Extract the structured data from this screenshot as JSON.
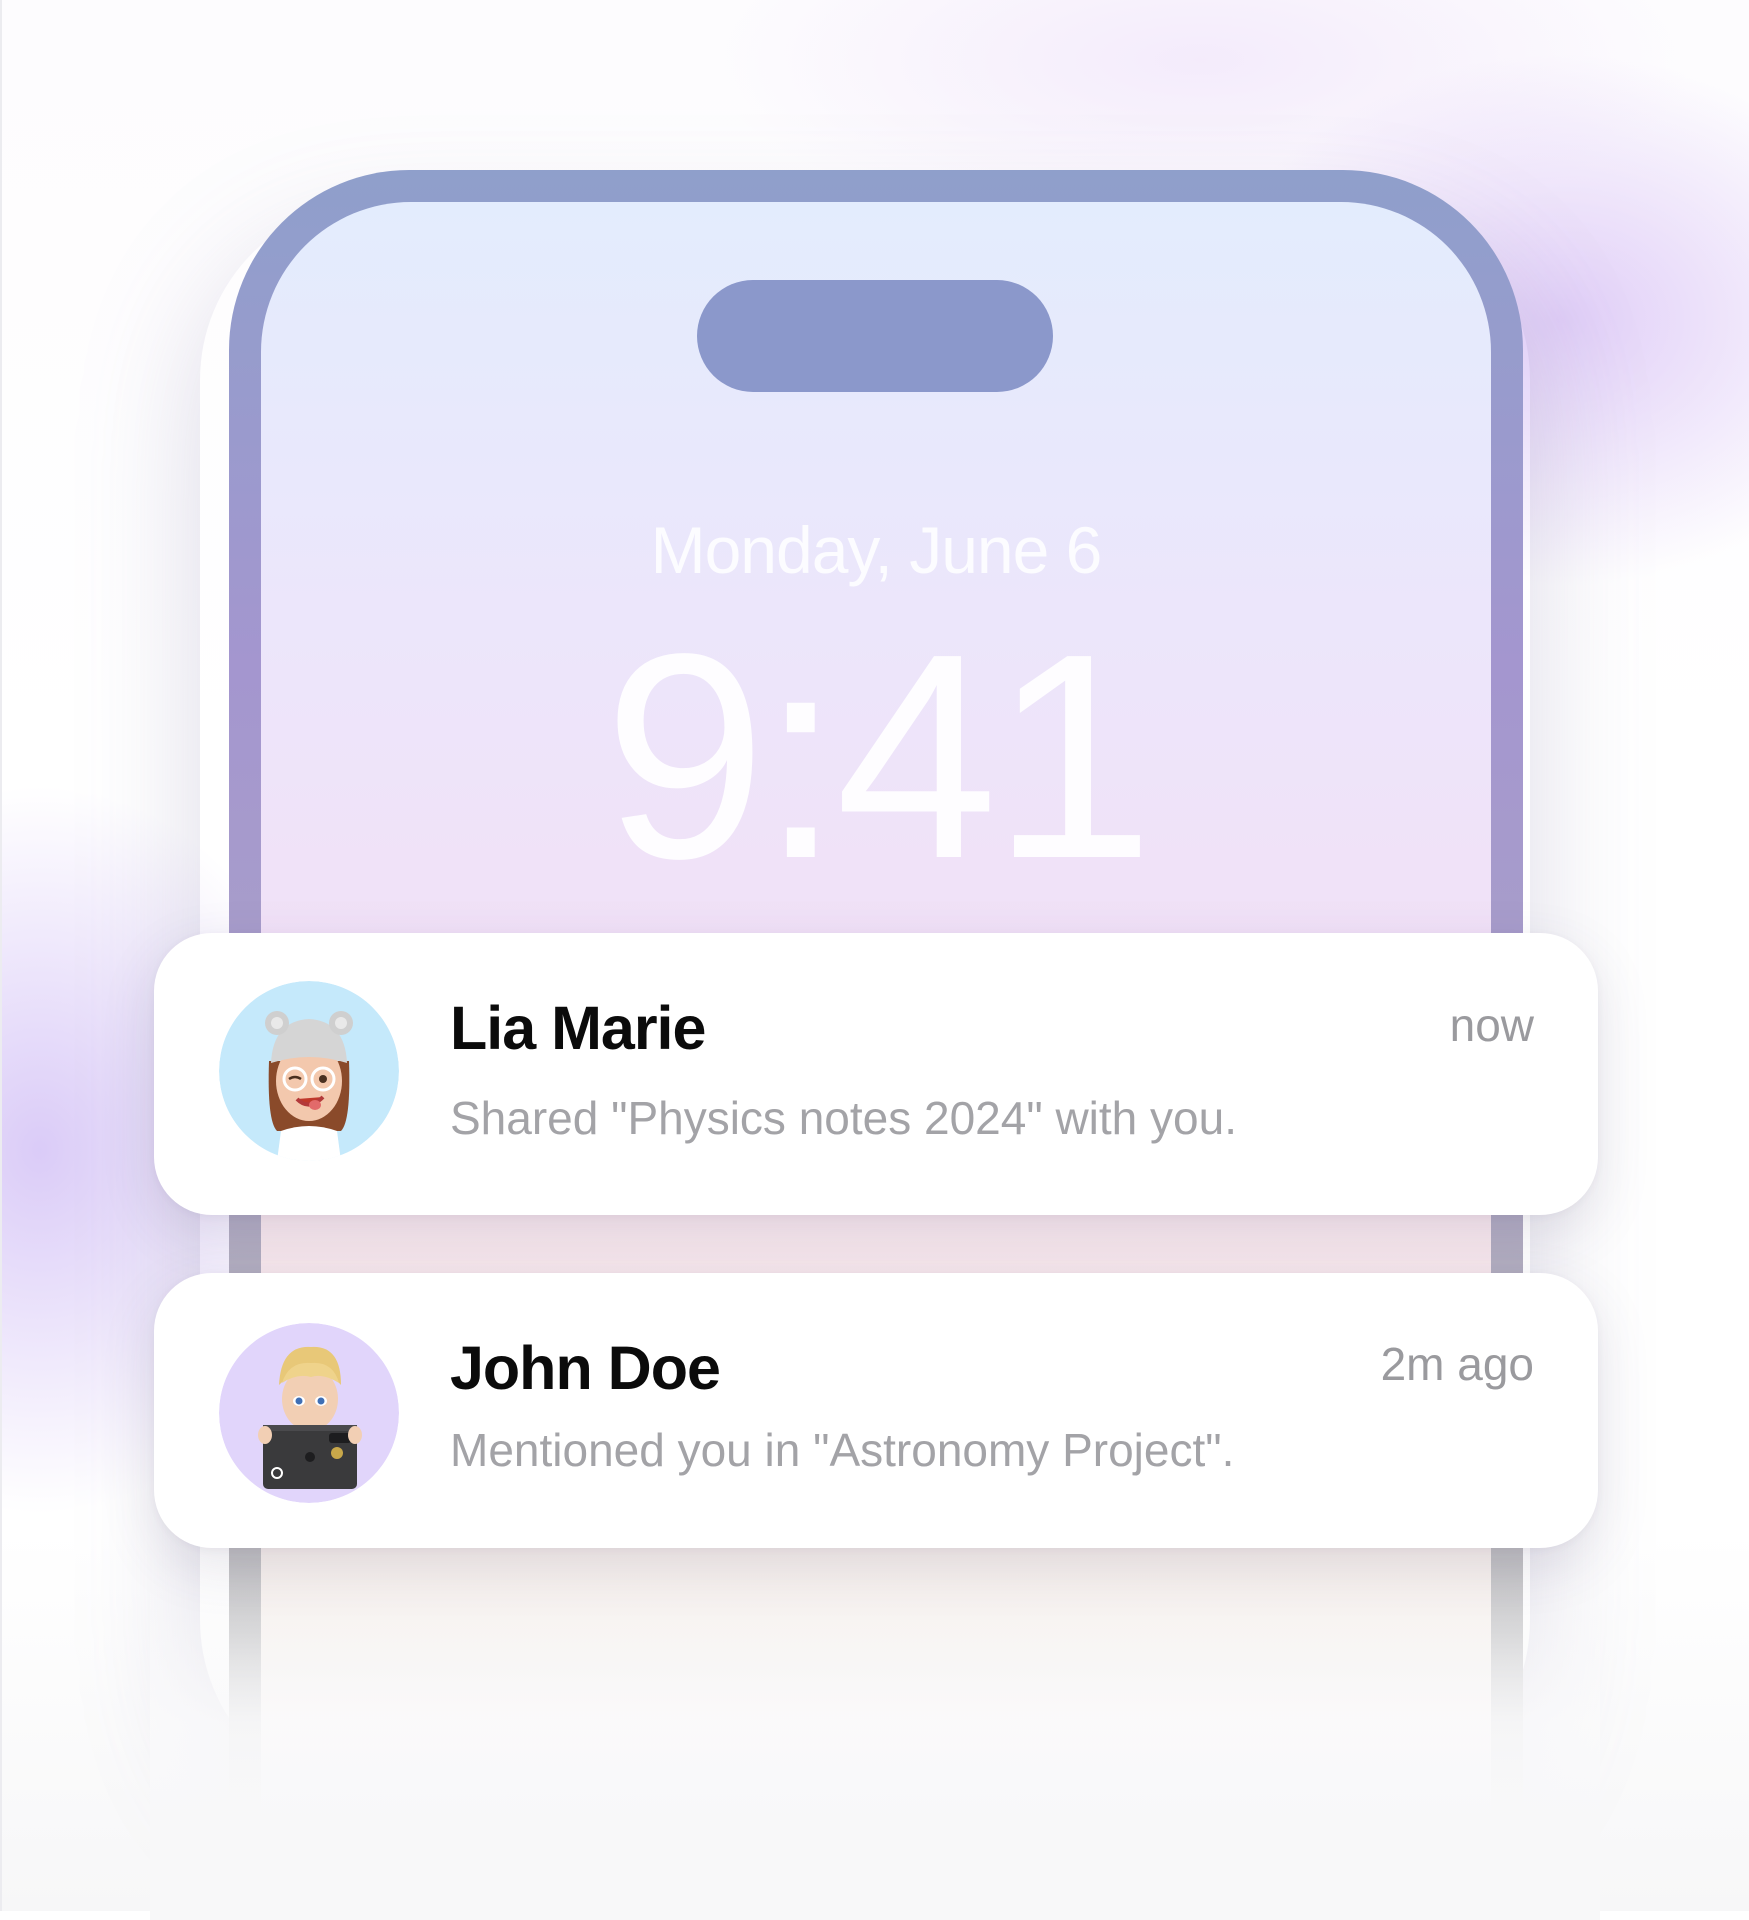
{
  "lock_screen": {
    "date": "Monday, June 6",
    "time": "9:41"
  },
  "notifications": [
    {
      "sender": "Lia Marie",
      "time": "now",
      "message": "Shared \"Physics notes 2024\" with you.",
      "avatar": "memoji-girl-beanie-winking",
      "avatar_bg": "#c5e9fb"
    },
    {
      "sender": "John Doe",
      "time": "2m ago",
      "message": "Mentioned you in \"Astronomy Project\".",
      "avatar": "memoji-boy-laptop",
      "avatar_bg": "#e1d5fb"
    }
  ],
  "colors": {
    "phone_frame": "#a496cf",
    "dynamic_island": "#8b98cb",
    "sender_text": "#0b0b0b",
    "secondary_text": "#a3a3a7"
  }
}
